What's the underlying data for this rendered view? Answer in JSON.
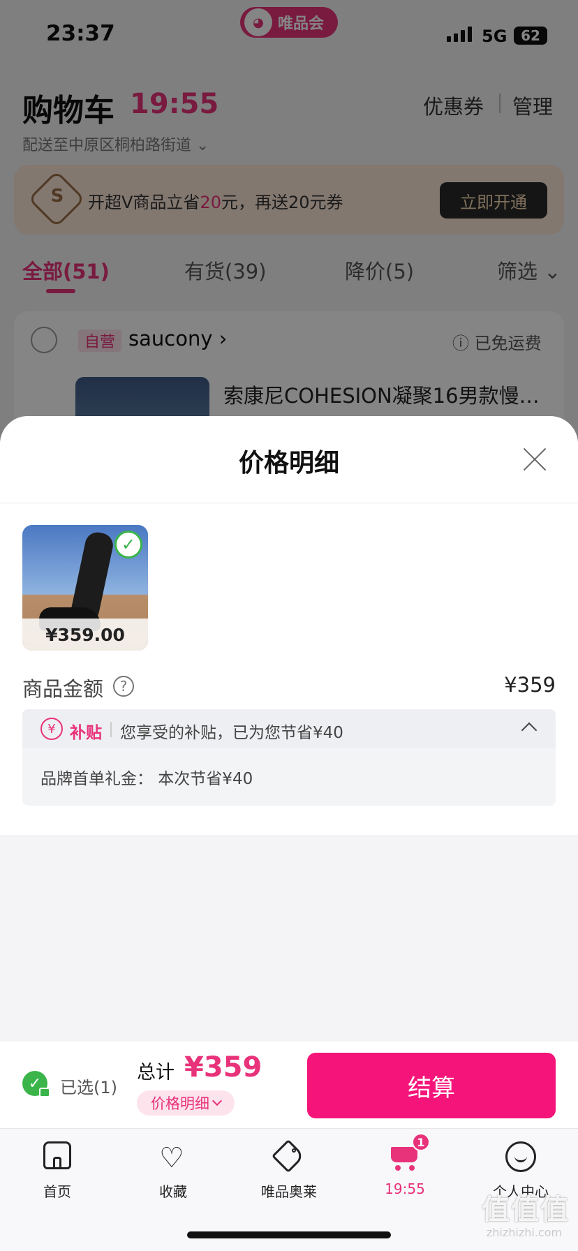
{
  "status": {
    "time": "23:37",
    "app_badge": "唯品会",
    "network": "5G",
    "battery": "62"
  },
  "cart": {
    "title": "购物车",
    "timer": "19:55",
    "coupon_link": "优惠券",
    "manage_link": "管理",
    "address": "配送至中原区桐柏路街道",
    "vip_banner": {
      "text_before": "开超V商品立省",
      "highlight": "20",
      "text_after": "元，再送20元券",
      "button": "立即开通",
      "icon_letter": "S"
    },
    "tabs": [
      {
        "label": "全部(51)",
        "active": true
      },
      {
        "label": "有货(39)",
        "active": false
      },
      {
        "label": "降价(5)",
        "active": false
      },
      {
        "label": "筛选",
        "active": false
      }
    ],
    "shop": {
      "self_tag": "自营",
      "name": "saucony",
      "shipping": "已免运费",
      "item_title": "索康尼COHESION凝聚16男款慢…"
    }
  },
  "sheet": {
    "title": "价格明细",
    "product_price": "¥359.00",
    "amount_label": "商品金额",
    "amount_value": "¥359",
    "subsidy": {
      "icon": "¥",
      "tag": "补贴",
      "summary": "您享受的补贴，已为您节省¥40",
      "row": "品牌首单礼金：  本次节省¥40"
    }
  },
  "checkout": {
    "selected": "已选(1)",
    "total_label": "总计",
    "total_value": "¥359",
    "detail_button": "价格明细",
    "pay_button": "结算"
  },
  "tab_bar": {
    "items": [
      {
        "label": "首页",
        "icon": "home-icon"
      },
      {
        "label": "收藏",
        "icon": "heart-icon"
      },
      {
        "label": "唯品奥莱",
        "icon": "tag-icon"
      },
      {
        "label": "19:55",
        "icon": "cart-icon",
        "active": true,
        "badge": "1"
      },
      {
        "label": "个人中心",
        "icon": "profile-icon"
      }
    ]
  },
  "watermark": {
    "main": "值值值",
    "sub": "zhizhizhi.com"
  },
  "colors": {
    "accent": "#e8327a",
    "pay_button": "#f5157a",
    "check_green": "#3bb54a"
  }
}
